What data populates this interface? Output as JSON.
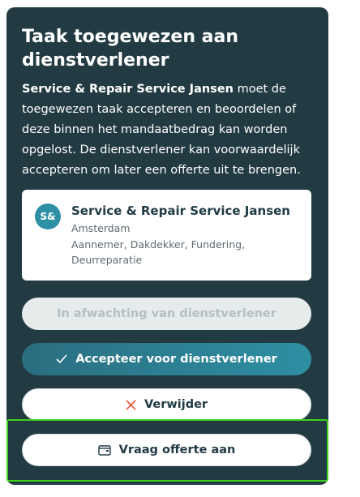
{
  "panel": {
    "title": "Taak toegewezen aan dienstverlener",
    "description_bold": "Service & Repair Service Jansen",
    "description_rest": " moet de toegewezen taak accepteren en beoordelen of deze binnen het mandaatbedrag kan worden opgelost. De dienstverlener kan voorwaardelijk accepteren om later een offerte uit te brengen."
  },
  "vendor": {
    "initials": "S&",
    "name": "Service & Repair Service Jansen",
    "city": "Amsterdam",
    "trades": "Aannemer, Dakdekker, Fundering, Deurreparatie"
  },
  "buttons": {
    "waiting": "In afwachting van dienstverlener",
    "accept": "Accepteer voor dienstverlener",
    "delete": "Verwijder",
    "quote": "Vraag offerte aan"
  },
  "icons": {
    "accept": "check-icon",
    "delete": "close-icon",
    "quote": "wallet-icon"
  },
  "colors": {
    "panel_bg": "#223b42",
    "accent": "#2f8fa3",
    "delete_icon": "#e8553c",
    "highlight": "#3ed11e"
  }
}
